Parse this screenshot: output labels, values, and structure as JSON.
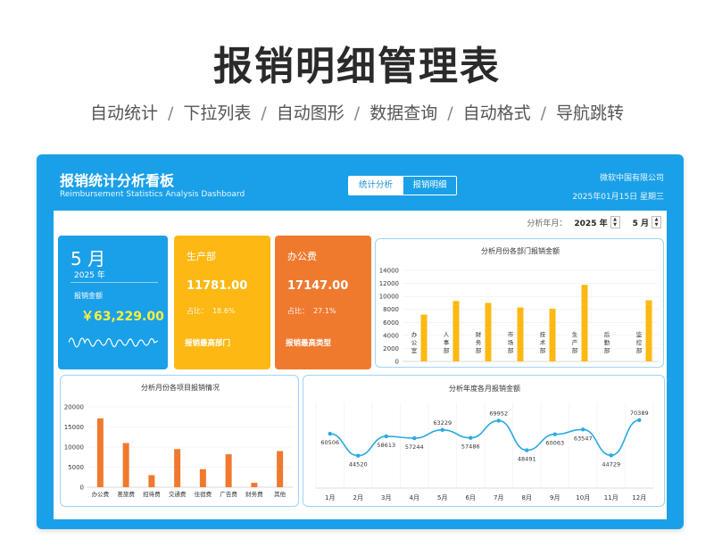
{
  "page": {
    "title": "报销明细管理表",
    "features": [
      "自动统计",
      "下拉列表",
      "自动图形",
      "数据查询",
      "自动格式",
      "导航跳转"
    ],
    "separator": "/"
  },
  "dashboard": {
    "title": "报销统计分析看板",
    "subtitle": "Reimbursement Statistics Analysis Dashboard",
    "company": "微软中国有限公司",
    "date": "2025年01月15日  星期三",
    "tabs": [
      {
        "label": "统计分析",
        "active": true
      },
      {
        "label": "报销明细",
        "active": false
      }
    ],
    "selector": {
      "label": "分析年月：",
      "year": "2025 年",
      "month": "5 月"
    }
  },
  "cards": {
    "month": {
      "title": "5 月",
      "year": "2025 年",
      "label": "报销金额",
      "amount": "￥63,229.00"
    },
    "department": {
      "title": "生产部",
      "value": "11781.00",
      "share_label": "占比：",
      "share": "18.6%",
      "footer": "报销最高部门"
    },
    "type": {
      "title": "办公费",
      "value": "17147.00",
      "share_label": "占比：",
      "share": "27.1%",
      "footer": "报销最高类型"
    }
  },
  "colors": {
    "accent": "#1aa0e8",
    "yellow": "#fdb813",
    "orange": "#ef7a2e",
    "line": "#29a9e1",
    "amount": "#ffef3a"
  },
  "chart_data": [
    {
      "type": "bar",
      "title": "分析月份各部门报销金额",
      "categories": [
        "办公室",
        "人事部",
        "财务部",
        "市场部",
        "技术部",
        "生产部",
        "后勤部",
        "监控部"
      ],
      "values": [
        7200,
        9300,
        9000,
        8300,
        8100,
        11781,
        0,
        9400
      ],
      "ylim": [
        0,
        14000
      ],
      "yticks": [
        0,
        2000,
        4000,
        6000,
        8000,
        10000,
        12000,
        14000
      ],
      "color": "#fdb813"
    },
    {
      "type": "bar",
      "title": "分析月份各项目报销情况",
      "categories": [
        "办公费",
        "差旅费",
        "招待费",
        "交通费",
        "住宿费",
        "广告费",
        "财务费",
        "其他"
      ],
      "values": [
        17147,
        11000,
        3000,
        9500,
        4500,
        8200,
        1100,
        9000
      ],
      "ylim": [
        0,
        20000
      ],
      "yticks": [
        0,
        5000,
        10000,
        15000,
        20000
      ],
      "color": "#ef7a2e"
    },
    {
      "type": "line",
      "title": "分析年度各月报销金额",
      "categories": [
        "1月",
        "2月",
        "3月",
        "4月",
        "5月",
        "6月",
        "7月",
        "8月",
        "9月",
        "10月",
        "11月",
        "12月"
      ],
      "values": [
        60506,
        44520,
        58613,
        57244,
        63229,
        57486,
        69952,
        48491,
        60063,
        63547,
        44729,
        70389
      ],
      "ylim": [
        30000,
        80000
      ],
      "color": "#29a9e1"
    }
  ]
}
